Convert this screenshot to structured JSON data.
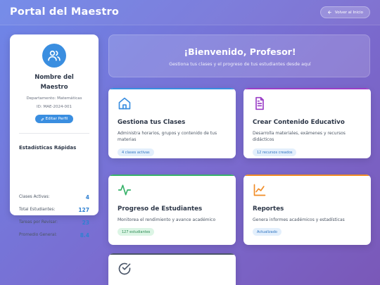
{
  "header": {
    "title": "Portal del Maestro",
    "back_label": "Volver al Inicio"
  },
  "profile": {
    "name": "Nombre del Maestro",
    "department": "Departamento: Matemáticas",
    "id": "ID: MAE-2024-001",
    "edit_label": "Editar Perfil",
    "avatar_icon": "users-icon"
  },
  "stats": {
    "title": "Estadísticas Rápidas",
    "items": [
      {
        "label": "Clases Activas:",
        "value": "4"
      },
      {
        "label": "Total Estudiantes:",
        "value": "127"
      },
      {
        "label": "Tareas por Revisar:",
        "value": "23"
      },
      {
        "label": "Promedio General:",
        "value": "8.4"
      }
    ]
  },
  "welcome": {
    "title": "¡Bienvenido, Profesor!",
    "subtitle": "Gestiona tus clases y el progreso de tus estudiantes desde aquí"
  },
  "cards": [
    {
      "title": "Gestiona tus Clases",
      "description": "Administra horarios, grupos y contenido de tus materias",
      "badge": "4 clases activas",
      "icon": "home-icon",
      "accent": "#3a8ee0"
    },
    {
      "title": "Crear Contenido Educativo",
      "description": "Desarrolla materiales, exámenes y recursos didácticos",
      "badge": "12 recursos creados",
      "icon": "document-icon",
      "accent": "#9b3fc7"
    },
    {
      "title": "Progreso de Estudiantes",
      "description": "Monitorea el rendimiento y avance académico",
      "badge": "127 estudiantes",
      "icon": "activity-icon",
      "accent": "#38b26a"
    },
    {
      "title": "Reportes",
      "description": "Genera informes académicos y estadísticas",
      "badge": "Actualizado",
      "icon": "chart-icon",
      "accent": "#f08c26"
    },
    {
      "title": "",
      "description": "",
      "badge": "",
      "icon": "check-circle-icon",
      "accent": "#4a5568"
    }
  ],
  "colors": {
    "primary": "#3a8ee0",
    "purple": "#9b3fc7",
    "green": "#38b26a",
    "orange": "#f08c26"
  }
}
